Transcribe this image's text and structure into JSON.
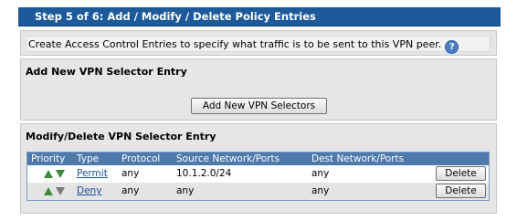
{
  "header": {
    "title": "Step 5 of 6: Add / Modify / Delete Policy Entries"
  },
  "description": {
    "text": "Create Access Control Entries to specify what traffic is to be sent to this VPN peer.",
    "help_icon": "?"
  },
  "add_section": {
    "title": "Add New VPN Selector Entry",
    "button_label": "Add New VPN Selectors"
  },
  "modify_section": {
    "title": "Modify/Delete VPN Selector Entry",
    "columns": [
      "Priority",
      "Type",
      "Protocol",
      "Source Network/Ports",
      "Dest Network/Ports"
    ],
    "rows": [
      {
        "type": "Permit",
        "protocol": "any",
        "source": "10.1.2.0/24",
        "dest": "any",
        "delete_label": "Delete"
      },
      {
        "type": "Deny",
        "protocol": "any",
        "source": "any",
        "dest": "any",
        "delete_label": "Delete"
      }
    ]
  }
}
